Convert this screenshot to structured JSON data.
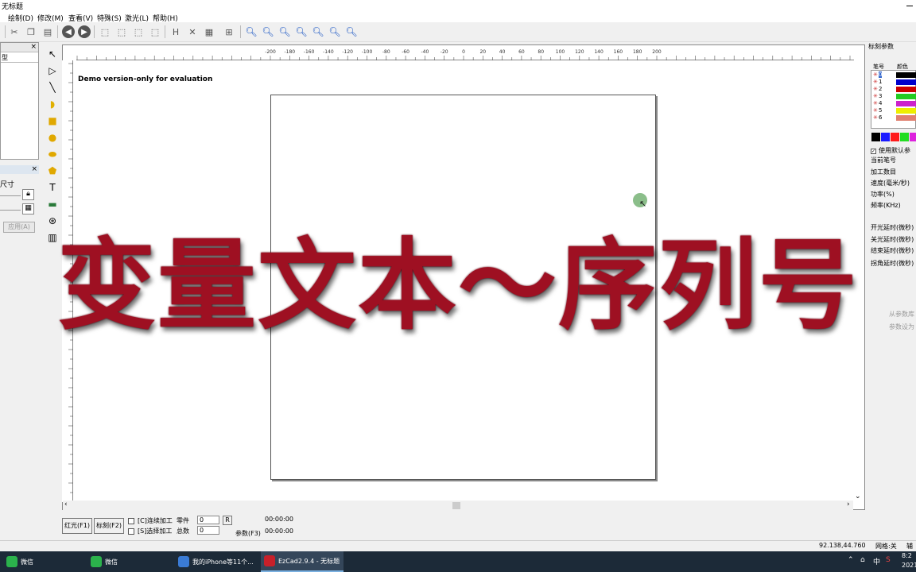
{
  "window": {
    "title": "无标题"
  },
  "menu": [
    "绘制(D)",
    "修改(M)",
    "查看(V)",
    "特殊(S)",
    "激光(L)",
    "帮助(H)"
  ],
  "left_panel": {
    "object_list_column": "型",
    "size_label": "尺寸",
    "apply_button": "应用(A)"
  },
  "canvas": {
    "demo_text": "Demo version-only for evaluation",
    "h_ruler_ticks": [
      "-200",
      "-180",
      "-160",
      "-140",
      "-120",
      "-100",
      "-80",
      "-60",
      "-40",
      "-20",
      "0",
      "20",
      "40",
      "60",
      "80",
      "100",
      "120",
      "140",
      "160",
      "180",
      "200"
    ]
  },
  "bottom": {
    "red_light_button": "红光(F1)",
    "mark_button": "标刻(F2)",
    "continuous_label": "[C]连续加工",
    "selected_label": "[S]选择加工",
    "parts_label": "零件",
    "parts_value": "0",
    "total_label": "总数",
    "total_value": "0",
    "reset_button": "R",
    "time1": "00:00:00",
    "time2": "00:00:00",
    "params_button": "参数(F3)"
  },
  "right_panel": {
    "title": "标刻参数",
    "col_pen": "笔号",
    "col_color": "颜色",
    "pens": [
      {
        "n": "0",
        "color": "#000000"
      },
      {
        "n": "1",
        "color": "#0000cc"
      },
      {
        "n": "2",
        "color": "#cc0000"
      },
      {
        "n": "3",
        "color": "#22cc22"
      },
      {
        "n": "4",
        "color": "#cc22cc"
      },
      {
        "n": "5",
        "color": "#eeee00"
      },
      {
        "n": "6",
        "color": "#e08070"
      }
    ],
    "palette": [
      "#000000",
      "#1a1aff",
      "#ff1a1a",
      "#22dd22",
      "#dd22dd"
    ],
    "use_default": "使用默认参",
    "current_pen": "当前笔号",
    "process_count": "加工数目",
    "speed": "速度(毫米/秒)",
    "power": "功率(%)",
    "frequency": "频率(KHz)",
    "open_delay": "开光延时(微秒)",
    "close_delay": "关光延时(微秒)",
    "end_delay": "结束延时(微秒)",
    "corner_delay": "拐角延时(微秒)",
    "from_lib": "从参数库",
    "restore": "参数设为"
  },
  "status": {
    "coords": "92.138,44.760",
    "grid": "网格:关",
    "misc": "辅"
  },
  "taskbar": {
    "items": [
      "微信",
      "微信",
      "我的iPhone等11个...",
      "EzCad2.9.4 - 无标题"
    ],
    "tray_ime": "中",
    "clock_time": "8:2",
    "clock_date": "2021"
  },
  "overlay_title": "变量文本～序列号"
}
